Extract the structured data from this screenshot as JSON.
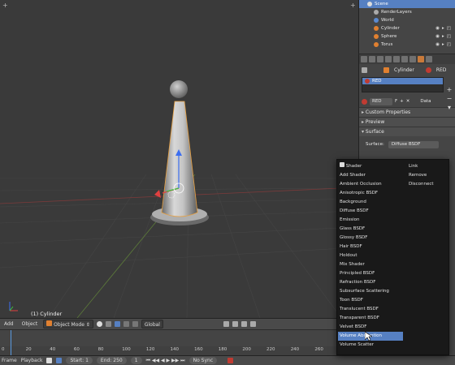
{
  "viewport": {
    "object_label": "(1) Cylinder"
  },
  "header3d": {
    "items": [
      "Add",
      "Object",
      "Object Mode",
      "Global"
    ]
  },
  "timeline": {
    "ruler": [
      "0",
      "20",
      "40",
      "60",
      "80",
      "100",
      "120",
      "140",
      "160",
      "180",
      "200",
      "220",
      "240",
      "260"
    ]
  },
  "tl_header": {
    "frame": "Frame",
    "playback": "Playback",
    "start_label": "Start:",
    "start_value": "1",
    "end_label": "End:",
    "end_value": "250",
    "current": "1",
    "sync": "No Sync"
  },
  "outliner": {
    "rows": [
      "Scene",
      "RenderLayers",
      "World",
      "Cylinder",
      "Sphere",
      "Torus"
    ]
  },
  "properties": {
    "crumb_object": "Cylinder",
    "crumb_material": "RED",
    "slot_name": "RED",
    "material_field": "RED",
    "material_users": "F",
    "data_label": "Data",
    "panels": [
      "Custom Properties",
      "Preview",
      "Surface"
    ],
    "surface_label": "Surface:",
    "surface_value": "Diffuse BSDF"
  },
  "menu": {
    "left_items": [
      "Shader",
      "Add Shader",
      "Ambient Occlusion",
      "Anisotropic BSDF",
      "Background",
      "Diffuse BSDF",
      "Emission",
      "Glass BSDF",
      "Glossy BSDF",
      "Hair BSDF",
      "Holdout",
      "Mix Shader",
      "Principled BSDF",
      "Refraction BSDF",
      "Subsurface Scattering",
      "Toon BSDF",
      "Translucent BSDF",
      "Transparent BSDF",
      "Velvet BSDF",
      "Volume Absorption",
      "Volume Scatter"
    ],
    "right_items": [
      "Link",
      "Remove",
      "Disconnect"
    ],
    "highlighted": "Volume Absorption"
  },
  "colors": {
    "selection": "#5680c2",
    "material_red": "#c03b32",
    "viewport_bg": "#3a3a3a"
  }
}
